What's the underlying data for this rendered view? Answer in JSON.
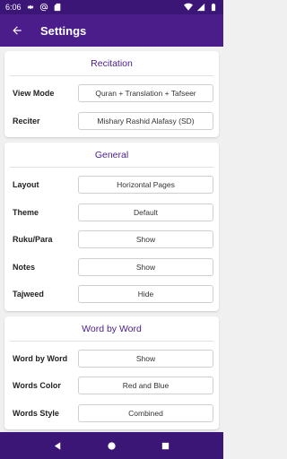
{
  "status_bar": {
    "time": "6:06"
  },
  "app_bar": {
    "title": "Settings"
  },
  "sections": [
    {
      "title": "Recitation",
      "rows": [
        {
          "label": "View Mode",
          "value": "Quran + Translation + Tafseer"
        },
        {
          "label": "Reciter",
          "value": "Mishary Rashid Alafasy (SD)"
        }
      ]
    },
    {
      "title": "General",
      "rows": [
        {
          "label": "Layout",
          "value": "Horizontal Pages"
        },
        {
          "label": "Theme",
          "value": "Default"
        },
        {
          "label": "Ruku/Para",
          "value": "Show"
        },
        {
          "label": "Notes",
          "value": "Show"
        },
        {
          "label": "Tajweed",
          "value": "Hide"
        }
      ]
    },
    {
      "title": "Word by Word",
      "rows": [
        {
          "label": "Word by Word",
          "value": "Show"
        },
        {
          "label": "Words Color",
          "value": "Red and Blue"
        },
        {
          "label": "Words Style",
          "value": "Combined"
        }
      ]
    }
  ],
  "colors": {
    "primary": "#4a1d8a",
    "status_bar": "#3c1677",
    "background": "#f0f0f0"
  },
  "icons": {
    "status_left": [
      "gear-icon",
      "at-icon",
      "sim-card-icon"
    ],
    "status_right": [
      "wifi-icon",
      "signal-icon",
      "battery-icon"
    ],
    "back": "arrow-left-icon",
    "nav": [
      "back-triangle-icon",
      "home-circle-icon",
      "recents-square-icon"
    ]
  }
}
